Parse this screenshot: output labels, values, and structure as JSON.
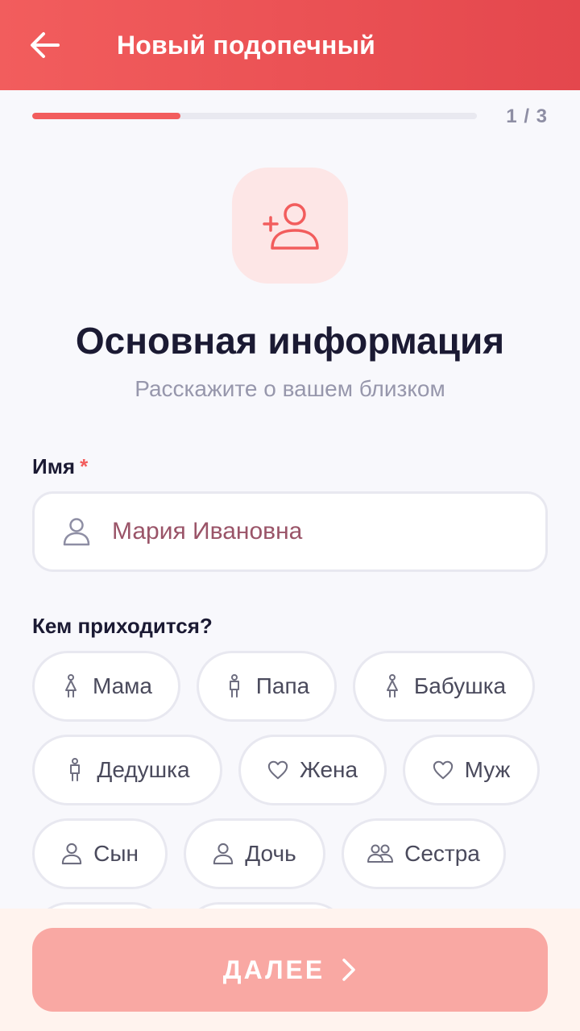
{
  "header": {
    "title": "Новый подопечный",
    "back_icon": "arrow-left-icon"
  },
  "progress": {
    "label": "1 / 3",
    "step": 1,
    "total": 3,
    "fraction": 0.333
  },
  "hero": {
    "icon": "user-plus-icon",
    "title": "Основная информация",
    "subtitle": "Расскажите о вашем близком"
  },
  "name_field": {
    "label": "Имя",
    "required_mark": "*",
    "value": "Мария Ивановна",
    "icon": "person-icon"
  },
  "relation": {
    "label": "Кем приходится?",
    "options": [
      {
        "label": "Мама",
        "icon": "female-figure-icon"
      },
      {
        "label": "Папа",
        "icon": "male-figure-icon"
      },
      {
        "label": "Бабушка",
        "icon": "female-figure-icon"
      },
      {
        "label": "Дедушка",
        "icon": "male-figure-icon"
      },
      {
        "label": "Жена",
        "icon": "heart-icon"
      },
      {
        "label": "Муж",
        "icon": "heart-icon"
      },
      {
        "label": "Сын",
        "icon": "person-icon"
      },
      {
        "label": "Дочь",
        "icon": "person-icon"
      },
      {
        "label": "Сестра",
        "icon": "people-icon"
      }
    ]
  },
  "footer": {
    "next_label": "ДАЛЕЕ",
    "next_icon": "chevron-right-icon"
  },
  "colors": {
    "accent": "#f25d5d",
    "header_gradient_end": "#e4474d",
    "button_disabled": "#f9a8a3",
    "text_dark": "#1b1a33",
    "text_muted": "#9797ac"
  }
}
